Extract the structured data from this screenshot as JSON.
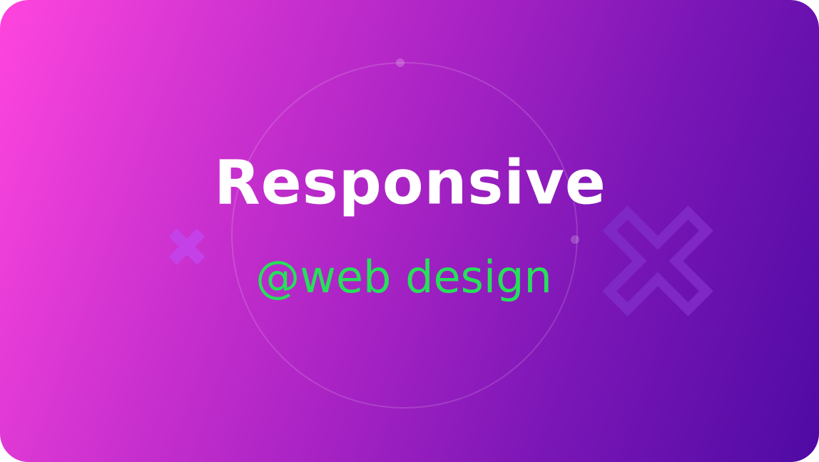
{
  "banner": {
    "title": "Responsive",
    "subtitle": "@web design"
  },
  "colors": {
    "gradient_start": "#ff45de",
    "gradient_end": "#4f0aa4",
    "title": "#ffffff",
    "subtitle": "#27e05a",
    "cross_small": "#c441e8",
    "cross_large_outline": "#7f28c6"
  },
  "icons": {
    "small_cross": "cross-icon",
    "large_cross": "cross-outline-icon"
  }
}
